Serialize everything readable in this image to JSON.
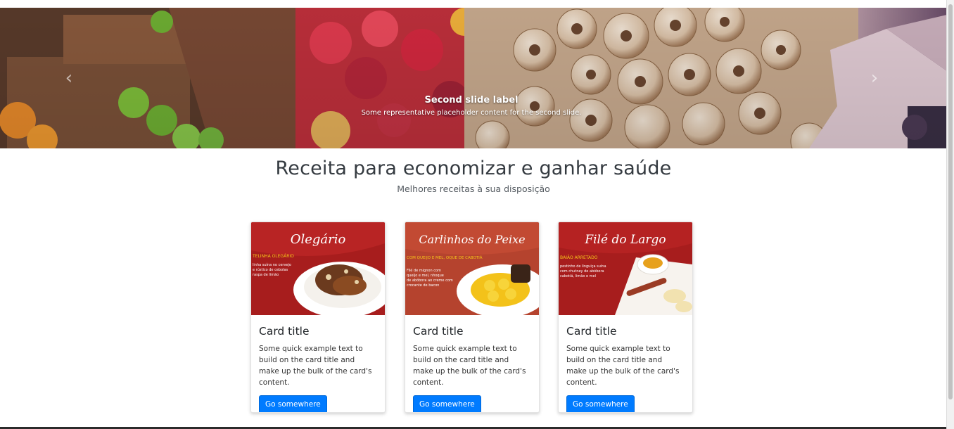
{
  "carousel": {
    "caption_title": "Second slide label",
    "caption_text": "Some representative placeholder content for the second slide.",
    "prev_icon": "chevron-left-icon",
    "next_icon": "chevron-right-icon"
  },
  "header": {
    "title": "Receita para economizar e ganhar saúde",
    "subtitle": "Melhores receitas à sua disposição"
  },
  "cards": [
    {
      "image_title": "Olegário",
      "image_subtitle": "TELINHA OLEGÁRIO",
      "image_lines": [
        "linha suína no cervejo",
        "e rústico de cebolas",
        "raspa de limão"
      ],
      "title": "Card title",
      "text": "Some quick example text to build on the card title and make up the bulk of the card's content.",
      "button": "Go somewhere"
    },
    {
      "image_title": "Carlinhos do Peixe",
      "image_subtitle": "COM QUEIJO E MEL, OQUE DE CABOTIÁ",
      "image_lines": [
        "Filé de mignon com",
        "queijo e mel, nhoque",
        "de abóbora ao creme com",
        "crocante de bacon"
      ],
      "title": "Card title",
      "text": "Some quick example text to build on the card title and make up the bulk of the card's content.",
      "button": "Go somewhere"
    },
    {
      "image_title": "Filé do Largo",
      "image_subtitle": "BAIÃO ARRETADO",
      "image_lines": [
        "pestinho de linguiça suína",
        "com chutney de abóbora",
        "cabotiá, limão e mel"
      ],
      "title": "Card title",
      "text": "Some quick example text to build on the card title and make up the bulk of the card's content.",
      "button": "Go somewhere"
    }
  ],
  "colors": {
    "primary_button": "#007bff",
    "card_red": "#a71d1d"
  }
}
